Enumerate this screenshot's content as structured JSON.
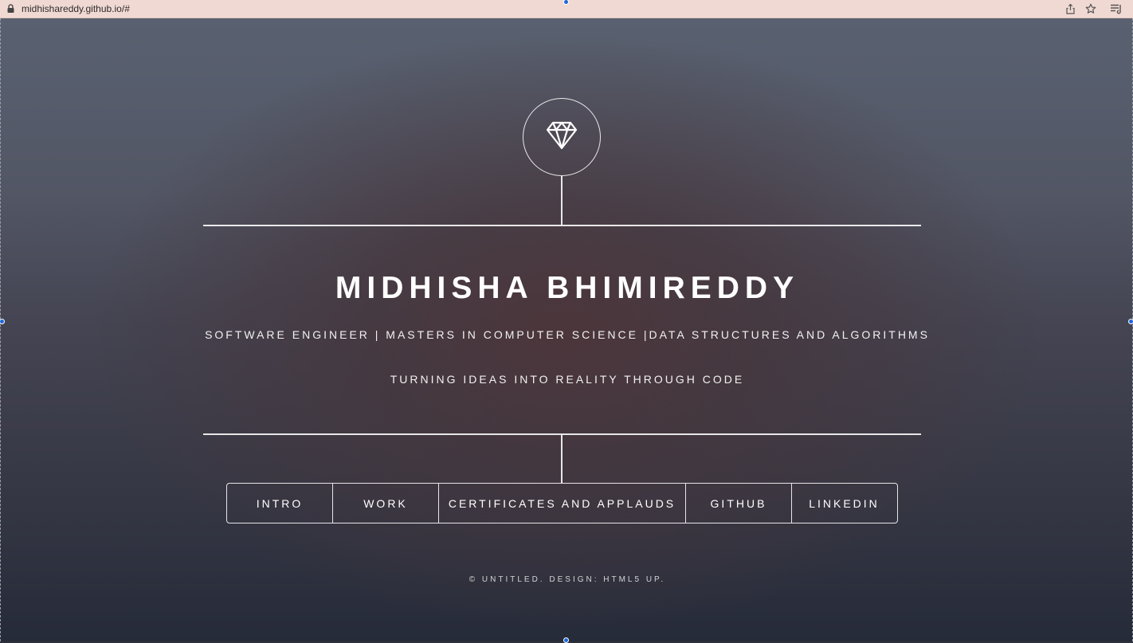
{
  "browser": {
    "url": "midhishareddy.github.io/#",
    "icons": [
      "lock-icon",
      "share-icon",
      "star-icon",
      "reading-list-icon"
    ]
  },
  "hero": {
    "logo_icon": "diamond-icon",
    "name": "MIDHISHA BHIMIREDDY",
    "subtitle": "SOFTWARE ENGINEER | MASTERS IN COMPUTER SCIENCE |DATA STRUCTURES AND ALGORITHMS",
    "tagline": "TURNING IDEAS INTO REALITY THROUGH CODE"
  },
  "nav": {
    "items": [
      {
        "label": "INTRO"
      },
      {
        "label": "WORK"
      },
      {
        "label": "CERTIFICATES AND APPLAUDS"
      },
      {
        "label": "GITHUB"
      },
      {
        "label": "LINKEDIN"
      }
    ]
  },
  "footer": {
    "text": "© UNTITLED. DESIGN: HTML5 UP."
  },
  "colors": {
    "browser_bar": "#f1d9d3",
    "line": "#ffffff",
    "text": "#ffffff",
    "selection_handle": "#1f67d8"
  }
}
